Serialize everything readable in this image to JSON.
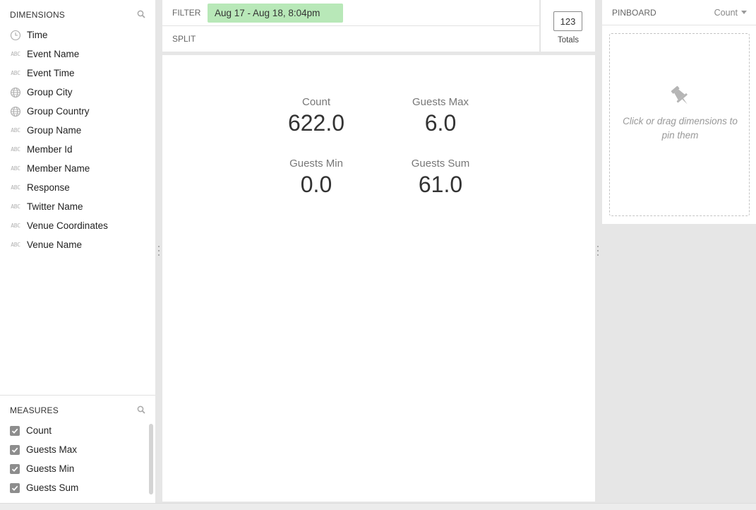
{
  "dimensions": {
    "title": "DIMENSIONS",
    "items": [
      {
        "icon": "clock-icon",
        "label": "Time"
      },
      {
        "icon": "abc-icon",
        "label": "Event Name"
      },
      {
        "icon": "abc-icon",
        "label": "Event Time"
      },
      {
        "icon": "globe-icon",
        "label": "Group City"
      },
      {
        "icon": "globe-icon",
        "label": "Group Country"
      },
      {
        "icon": "abc-icon",
        "label": "Group Name"
      },
      {
        "icon": "abc-icon",
        "label": "Member Id"
      },
      {
        "icon": "abc-icon",
        "label": "Member Name"
      },
      {
        "icon": "abc-icon",
        "label": "Response"
      },
      {
        "icon": "abc-icon",
        "label": "Twitter Name"
      },
      {
        "icon": "abc-icon",
        "label": "Venue Coordinates"
      },
      {
        "icon": "abc-icon",
        "label": "Venue Name"
      }
    ],
    "abc_glyph": "ABC"
  },
  "measures": {
    "title": "MEASURES",
    "items": [
      {
        "label": "Count",
        "checked": true
      },
      {
        "label": "Guests Max",
        "checked": true
      },
      {
        "label": "Guests Min",
        "checked": true
      },
      {
        "label": "Guests Sum",
        "checked": true
      }
    ]
  },
  "filter_bar": {
    "filter_label": "FILTER",
    "filter_chip": "Aug 17 - Aug 18, 8:04pm",
    "split_label": "SPLIT"
  },
  "totals": {
    "icon_text": "123",
    "label": "Totals"
  },
  "main": {
    "cells": [
      {
        "label": "Count",
        "value": "622.0"
      },
      {
        "label": "Guests Max",
        "value": "6.0"
      },
      {
        "label": "Guests Min",
        "value": "0.0"
      },
      {
        "label": "Guests Sum",
        "value": "61.0"
      }
    ]
  },
  "pinboard": {
    "title": "PINBOARD",
    "sort_label": "Count",
    "hint": "Click or drag dimensions to pin them"
  },
  "colors": {
    "filter_chip_bg": "#b8e8b8",
    "checkbox_bg": "#8d8d8d",
    "panel_bg": "#ffffff",
    "app_bg": "#e6e6e6"
  }
}
